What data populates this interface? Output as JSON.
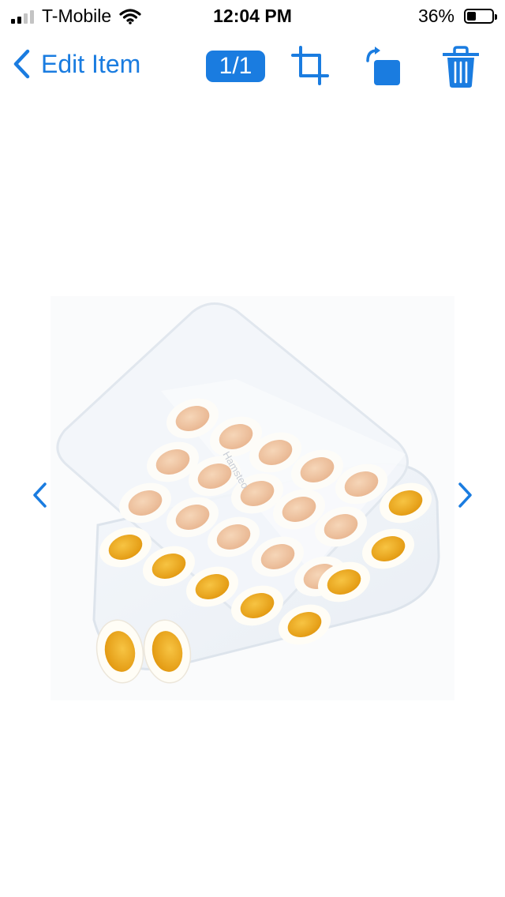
{
  "status_bar": {
    "carrier": "T-Mobile",
    "time": "12:04 PM",
    "battery_percent": "36%",
    "battery_level": 0.36,
    "signal_bars": 2
  },
  "nav": {
    "back_label": "Edit Item",
    "page_counter": "1/1"
  },
  "icons": {
    "back": "chevron-left-icon",
    "crop": "crop-icon",
    "rotate": "rotate-icon",
    "delete": "trash-icon",
    "prev": "chevron-left-icon",
    "next": "chevron-right-icon"
  },
  "colors": {
    "accent": "#1a7ce0",
    "yolk": "#f2ad1e",
    "tinted_yolk": "#f3c7a2"
  },
  "photo": {
    "logo_text": "Hamsteo"
  }
}
